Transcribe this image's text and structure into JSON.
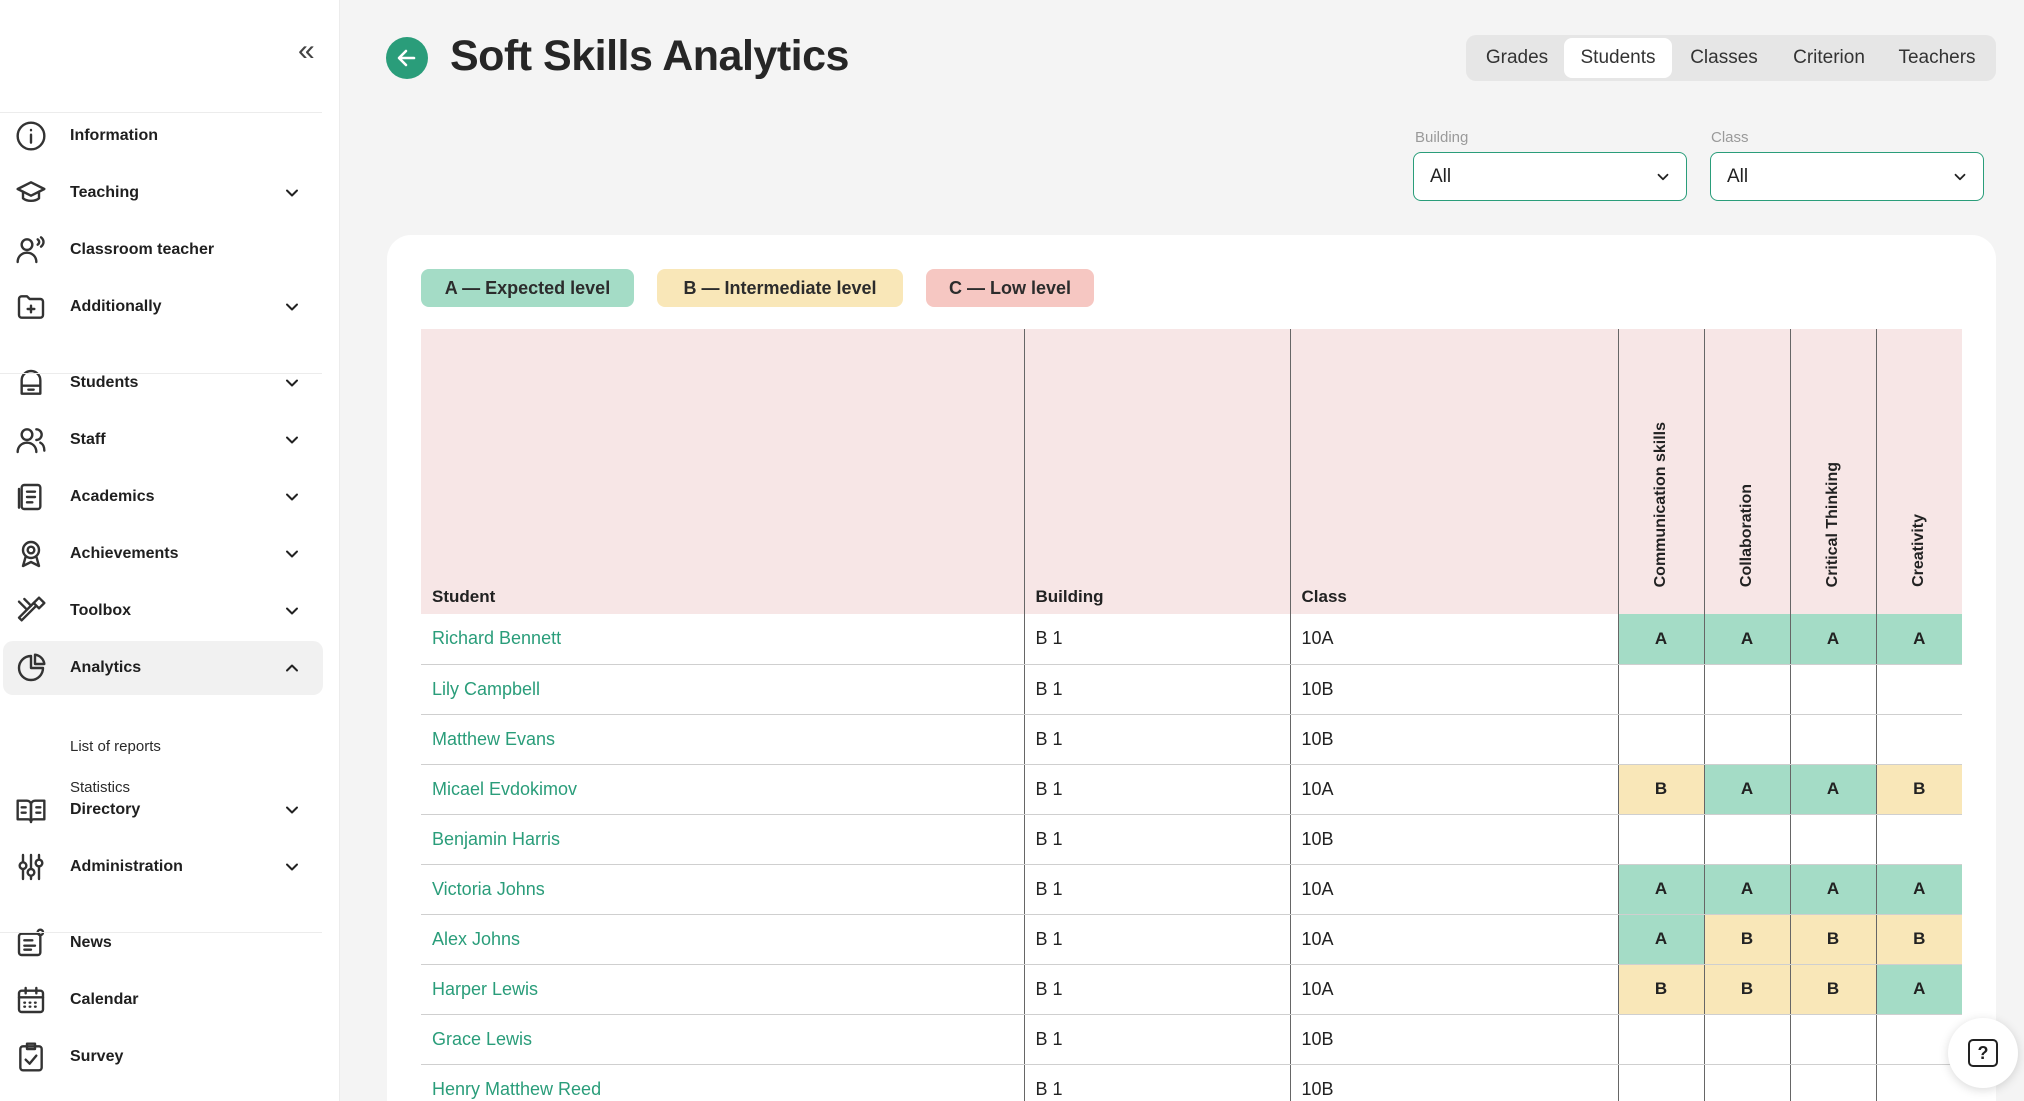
{
  "page": {
    "title": "Soft Skills Analytics"
  },
  "tabs": [
    {
      "label": "Grades",
      "active": false
    },
    {
      "label": "Students",
      "active": true
    },
    {
      "label": "Classes",
      "active": false
    },
    {
      "label": "Criterion",
      "active": false
    },
    {
      "label": "Teachers",
      "active": false
    }
  ],
  "filters": {
    "building": {
      "label": "Building",
      "value": "All"
    },
    "class": {
      "label": "Class",
      "value": "All"
    }
  },
  "legend": [
    {
      "label": "A — Expected level",
      "color": "#a4dcc6"
    },
    {
      "label": "B — Intermediate level",
      "color": "#f9e7b8"
    },
    {
      "label": "C — Low level",
      "color": "#f6c7c2"
    }
  ],
  "sidebar": {
    "items": [
      {
        "label": "Information",
        "icon": "info-icon",
        "chevron": ""
      },
      {
        "label": "Teaching",
        "icon": "graduation-cap-icon",
        "chevron": "down"
      },
      {
        "label": "Classroom teacher",
        "icon": "teacher-icon",
        "chevron": ""
      },
      {
        "label": "Additionally",
        "icon": "folder-plus-icon",
        "chevron": "down"
      },
      {
        "label": "Students",
        "icon": "backpack-icon",
        "chevron": "down"
      },
      {
        "label": "Staff",
        "icon": "users-icon",
        "chevron": "down"
      },
      {
        "label": "Academics",
        "icon": "document-icon",
        "chevron": "down"
      },
      {
        "label": "Achievements",
        "icon": "award-icon",
        "chevron": "down"
      },
      {
        "label": "Toolbox",
        "icon": "tools-icon",
        "chevron": "down"
      },
      {
        "label": "Analytics",
        "icon": "pie-chart-icon",
        "chevron": "up"
      },
      {
        "label": "Directory",
        "icon": "book-icon",
        "chevron": "down"
      },
      {
        "label": "Administration",
        "icon": "sliders-icon",
        "chevron": "down"
      },
      {
        "label": "News",
        "icon": "news-icon",
        "chevron": ""
      },
      {
        "label": "Calendar",
        "icon": "calendar-icon",
        "chevron": ""
      },
      {
        "label": "Survey",
        "icon": "clipboard-check-icon",
        "chevron": ""
      }
    ],
    "analytics_sub": [
      "List of reports",
      "Statistics"
    ]
  },
  "table": {
    "columns": [
      "Student",
      "Building",
      "Class",
      "Communication skills",
      "Collaboration",
      "Critical Thinking",
      "Creativity"
    ],
    "rows": [
      {
        "student": "Richard Bennett",
        "building": "B 1",
        "class": "10A",
        "grades": [
          "A",
          "A",
          "A",
          "A"
        ]
      },
      {
        "student": "Lily Campbell",
        "building": "B 1",
        "class": "10B",
        "grades": [
          "",
          "",
          "",
          ""
        ]
      },
      {
        "student": "Matthew Evans",
        "building": "B 1",
        "class": "10B",
        "grades": [
          "",
          "",
          "",
          ""
        ]
      },
      {
        "student": "Micael Evdokimov",
        "building": "B 1",
        "class": "10A",
        "grades": [
          "B",
          "A",
          "A",
          "B"
        ]
      },
      {
        "student": "Benjamin Harris",
        "building": "B 1",
        "class": "10B",
        "grades": [
          "",
          "",
          "",
          ""
        ]
      },
      {
        "student": "Victoria Johns",
        "building": "B 1",
        "class": "10A",
        "grades": [
          "A",
          "A",
          "A",
          "A"
        ]
      },
      {
        "student": "Alex Johns",
        "building": "B 1",
        "class": "10A",
        "grades": [
          "A",
          "B",
          "B",
          "B"
        ]
      },
      {
        "student": "Harper Lewis",
        "building": "B 1",
        "class": "10A",
        "grades": [
          "B",
          "B",
          "B",
          "A"
        ]
      },
      {
        "student": "Grace Lewis",
        "building": "B 1",
        "class": "10B",
        "grades": [
          "",
          "",
          "",
          ""
        ]
      },
      {
        "student": "Henry Matthew Reed",
        "building": "B 1",
        "class": "10B",
        "grades": [
          "",
          "",
          "",
          ""
        ]
      }
    ]
  },
  "help": {
    "icon": "help-icon",
    "glyph": "?"
  }
}
